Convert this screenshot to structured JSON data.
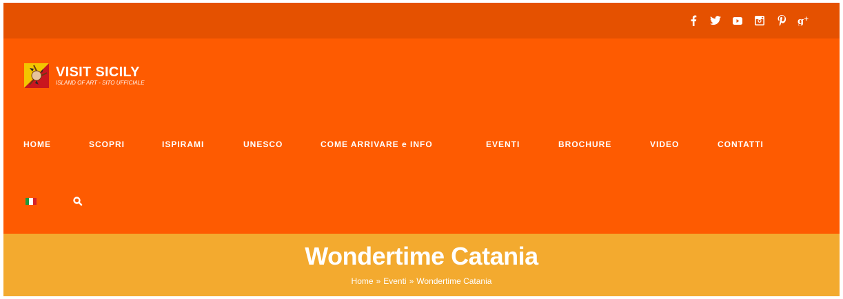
{
  "topbar": {
    "social": [
      {
        "icon": "facebook-icon",
        "glyph": "f"
      },
      {
        "icon": "twitter-icon",
        "glyph": "🐦"
      },
      {
        "icon": "youtube-icon",
        "glyph": "▶"
      },
      {
        "icon": "instagram-icon",
        "glyph": "◙"
      },
      {
        "icon": "pinterest-icon",
        "glyph": "℘"
      },
      {
        "icon": "google-plus-icon",
        "glyph": "g⁺"
      }
    ]
  },
  "logo": {
    "title": "VISIT SICILY",
    "subtitle": "ISLAND OF ART - SITO UFFICIALE"
  },
  "nav": {
    "items": [
      {
        "label": "HOME"
      },
      {
        "label": "SCOPRI"
      },
      {
        "label": "ISPIRAMI"
      },
      {
        "label": "UNESCO"
      },
      {
        "label": "COME ARRIVARE e INFO"
      },
      {
        "label": "EVENTI"
      },
      {
        "label": "BROCHURE"
      },
      {
        "label": "VIDEO"
      },
      {
        "label": "CONTATTI"
      }
    ]
  },
  "page": {
    "title": "Wondertime Catania",
    "breadcrumb": [
      "Home",
      "»",
      "Eventi",
      "»",
      "Wondertime Catania"
    ]
  },
  "colors": {
    "topbar": "#e55100",
    "header": "#fe5b01",
    "titlebar": "#f3aa2f"
  }
}
